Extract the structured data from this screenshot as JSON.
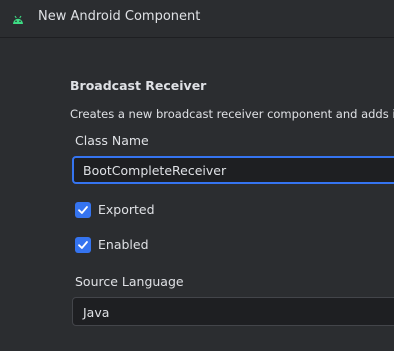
{
  "window": {
    "title": "New Android Component",
    "icon": "android-icon"
  },
  "component": {
    "heading": "Broadcast Receiver",
    "description": "Creates a new broadcast receiver component and adds it to yo"
  },
  "form": {
    "class_name_label": "Class Name",
    "class_name_value": "BootCompleteReceiver",
    "exported_label": "Exported",
    "exported_checked": true,
    "enabled_label": "Enabled",
    "enabled_checked": true,
    "source_language_label": "Source Language",
    "source_language_value": "Java"
  },
  "colors": {
    "background": "#2b2d30",
    "input_background": "#1e1f22",
    "accent": "#3574f0",
    "android_green": "#3ddc84",
    "text": "#dfe1e5"
  }
}
